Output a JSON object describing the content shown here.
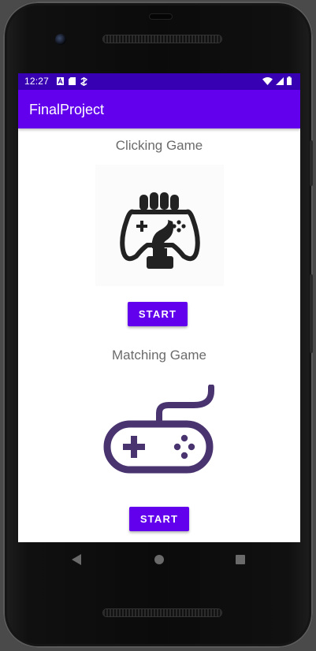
{
  "status_bar": {
    "time": "12:27",
    "left_icons": [
      "font-a-icon",
      "sd-card-icon",
      "data-saver-icon"
    ],
    "right_icons": [
      "wifi-icon",
      "signal-icon",
      "battery-icon"
    ]
  },
  "app_bar": {
    "title": "FinalProject"
  },
  "games": [
    {
      "title": "Clicking Game",
      "image_icon": "game-controller-fist-icon",
      "button_label": "START"
    },
    {
      "title": "Matching Game",
      "image_icon": "gamepad-icon",
      "button_label": "START"
    }
  ],
  "nav_bar": {
    "icons": [
      "back-icon",
      "home-icon",
      "recents-icon"
    ]
  },
  "colors": {
    "status_bar": "#3700b3",
    "primary": "#6200ee",
    "title_text": "#6b6b6b",
    "clicking_icon": "#222222",
    "matching_icon": "#4a3470"
  }
}
